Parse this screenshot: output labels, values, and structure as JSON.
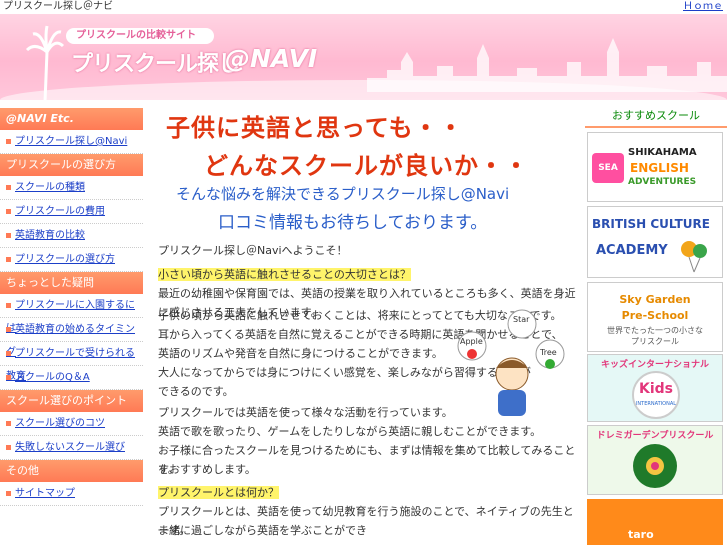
{
  "topbar": {
    "left": "プリスクール探し＠ナビ",
    "right": "Ｈｏｍｅ"
  },
  "header": {
    "badge": "プリスクールの比較サイト",
    "logo_jp": "プリスクール探し",
    "logo_en": "@NAVI"
  },
  "sidebar": {
    "sections": [
      {
        "title": "@NAVI Etc.",
        "items": [
          "プリスクール探し@Navi"
        ]
      },
      {
        "title": "プリスクールの選び方",
        "items": [
          "スクールの種類",
          "プリスクールの費用",
          "英語教育の比較",
          "プリスクールの選び方"
        ]
      },
      {
        "title": "ちょっとした疑問",
        "items": [
          "プリスクールに入園するには",
          "英語教育の始めるタイミング",
          "プリスクールで受けられる教育",
          "スクールのQ＆A"
        ]
      },
      {
        "title": "スクール選びのポイント",
        "items": [
          "スクール選びのコツ",
          "失敗しないスクール選び"
        ]
      },
      {
        "title": "その他",
        "items": [
          "サイトマップ"
        ]
      }
    ]
  },
  "main": {
    "hl1": "子供に英語と思っても・・",
    "hl2": "どんなスクールが良いか・・",
    "hl3": "そんな悩みを解決できるプリスクール探し@Navi",
    "hl4": "口コミ情報もお待ちしております。",
    "intro": "プリスクール探し＠Naviへようこそ！",
    "heading1": "小さい頃から英語に触れさせることの大切さとは？",
    "p1": "最近の幼稚園や保育園では、英語の授業を取り入れているところも多く、英語を身近に感じさせる工夫をしています。",
    "p2a": "子供の頃から英語に触れさせておくことは、将来にとってとても大切なことです。",
    "p2b": "耳から入ってくる英語を自然に覚えることができる時期に英語を聞かせることで、",
    "p2c": "英語のリズムや発音を自然に身につけることができます。",
    "p2d": "大人になってからでは身につけにくい感覚を、楽しみながら習得することが",
    "p2e": "できるのです。",
    "p3a": "プリスクールでは英語を使って様々な活動を行っています。",
    "p3b": "英語で歌を歌ったり、ゲームをしたりしながら英語に親しむことができます。",
    "p3c": "お子様に合ったスクールを見つけるためにも、まずは情報を集めて比較してみることをおすすめします。",
    "p3d": "す。",
    "heading2": "プリスクールとは何か？",
    "p4": "プリスクールとは、英語を使って幼児教育を行う施設のことで、ネイティブの先生と一緒に過ごしながら英語を学ぶことができ",
    "p4b": "ます。",
    "kid_words": [
      "Apple",
      "Star",
      "Tree"
    ]
  },
  "right": {
    "title": "おすすめスクール",
    "banners": [
      {
        "l1": "SHIKAHAMA",
        "l2": "ENGLISH",
        "l3": "ADVENTURES",
        "badge": "SEA"
      },
      {
        "l1": "BRITISH CULTURE",
        "l2": "ACADEMY"
      },
      {
        "l1": "Sky Garden",
        "l2": "Pre-School",
        "l3": "世界でたった一つの小さな",
        "l4": "プリスクール"
      },
      {
        "l1": "キッズインターナショナル",
        "l2": "Kids",
        "l3": "INTERNATIONAL"
      },
      {
        "l1": "ドレミガーデンプリスクール"
      },
      {
        "l1": "taro"
      }
    ]
  }
}
